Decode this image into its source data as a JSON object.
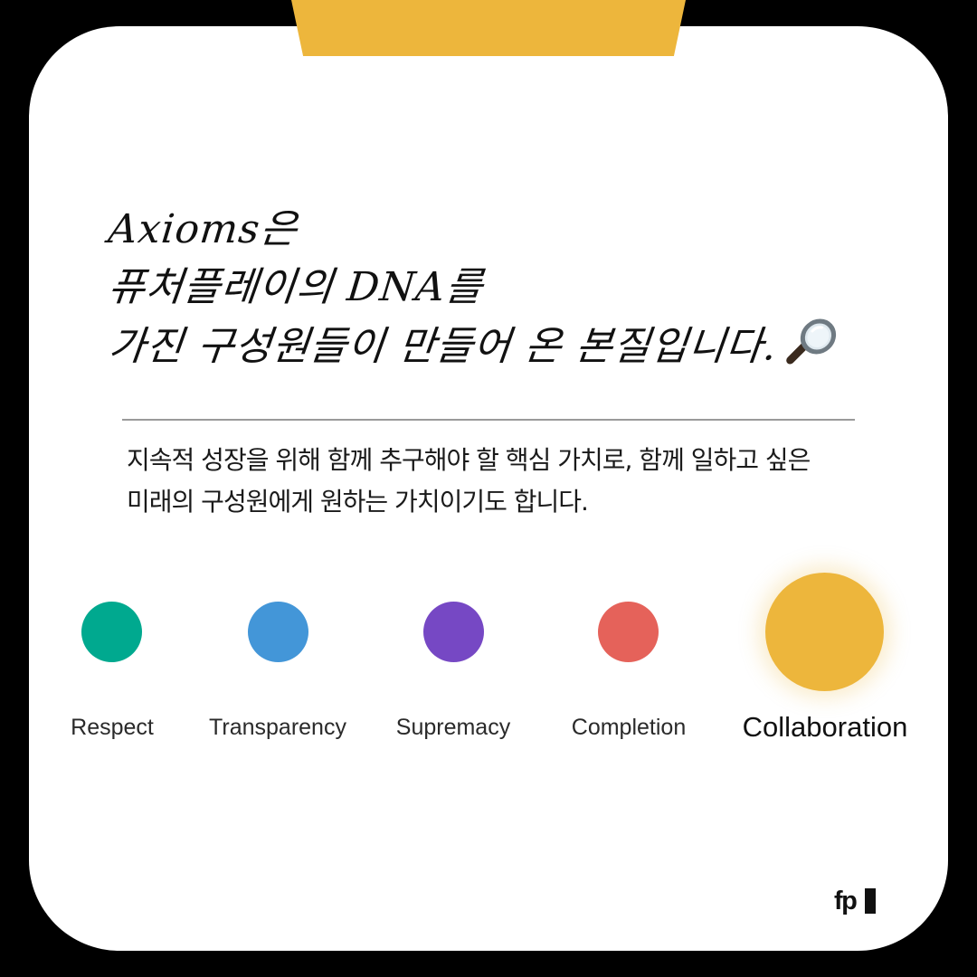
{
  "accent_color": "#EDB63C",
  "headline": {
    "line1": "Axioms은",
    "line2": "퓨처플레이의 DNA를",
    "line3": "가진 구성원들이 만들어 온 본질입니다.",
    "emoji_icon": "magnifying-glass-icon"
  },
  "description": {
    "line1": "지속적 성장을 위해 함께 추구해야 할 핵심 가치로, 함께 일하고 싶은",
    "line2": "미래의 구성원에게 원하는 가치이기도 합니다."
  },
  "values": [
    {
      "label": "Respect",
      "color": "#00A98F",
      "highlighted": false
    },
    {
      "label": "Transparency",
      "color": "#4396D8",
      "highlighted": false
    },
    {
      "label": "Supremacy",
      "color": "#7648C4",
      "highlighted": false
    },
    {
      "label": "Completion",
      "color": "#E5625A",
      "highlighted": false
    },
    {
      "label": "Collaboration",
      "color": "#EDB63C",
      "highlighted": true
    }
  ],
  "logo_text": "fp"
}
